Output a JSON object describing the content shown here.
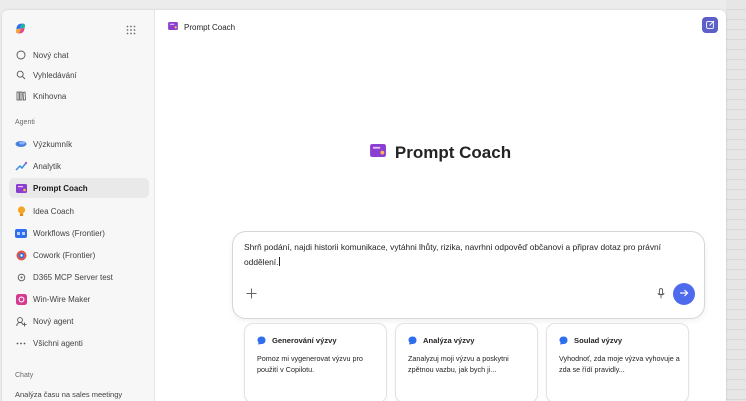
{
  "sidebar": {
    "items": [
      {
        "label": "Nový chat",
        "icon": "chat-bubble-icon"
      },
      {
        "label": "Vyhledávání",
        "icon": "search-icon"
      },
      {
        "label": "Knihovna",
        "icon": "library-icon"
      }
    ],
    "agents_label": "Agenti",
    "agents": [
      {
        "label": "Výzkumník",
        "icon": "researcher-icon"
      },
      {
        "label": "Analytik",
        "icon": "analyst-icon"
      },
      {
        "label": "Prompt Coach",
        "icon": "prompt-coach-icon",
        "active": true
      },
      {
        "label": "Idea Coach",
        "icon": "lightbulb-icon"
      },
      {
        "label": "Workflows (Frontier)",
        "icon": "workflows-icon"
      },
      {
        "label": "Cowork (Frontier)",
        "icon": "cowork-icon"
      },
      {
        "label": "D365 MCP Server test",
        "icon": "d365-icon"
      },
      {
        "label": "Win-Wire Maker",
        "icon": "winwire-icon"
      },
      {
        "label": "Nový agent",
        "icon": "new-agent-icon"
      },
      {
        "label": "Všichni agenti",
        "icon": "more-icon"
      }
    ],
    "chats_label": "Chaty",
    "chats": [
      "Analýza času na sales meetingy"
    ]
  },
  "header": {
    "title": "Prompt Coach"
  },
  "hero": {
    "title": "Prompt Coach"
  },
  "composer": {
    "text": "Shrň podání, najdi historii komunikace, vytáhni lhůty, rizika, navrhni odpověď občanovi a připrav dotaz pro právní oddělení."
  },
  "cards": [
    {
      "title": "Generování výzvy",
      "body": "Pomoz mi vygenerovat výzvu pro použití v Copilotu."
    },
    {
      "title": "Analýza výzvy",
      "body": "Zanalyzuj moji výzvu a poskytni zpětnou vazbu, jak bych ji..."
    },
    {
      "title": "Soulad výzvy",
      "body": "Vyhodnoť, zda moje výzva vyhovuje a zda se řídí pravidly..."
    }
  ],
  "colors": {
    "accent": "#5b5fc7",
    "send": "#4f6bed",
    "prompt_coach_icon": "#8b3fd1"
  }
}
